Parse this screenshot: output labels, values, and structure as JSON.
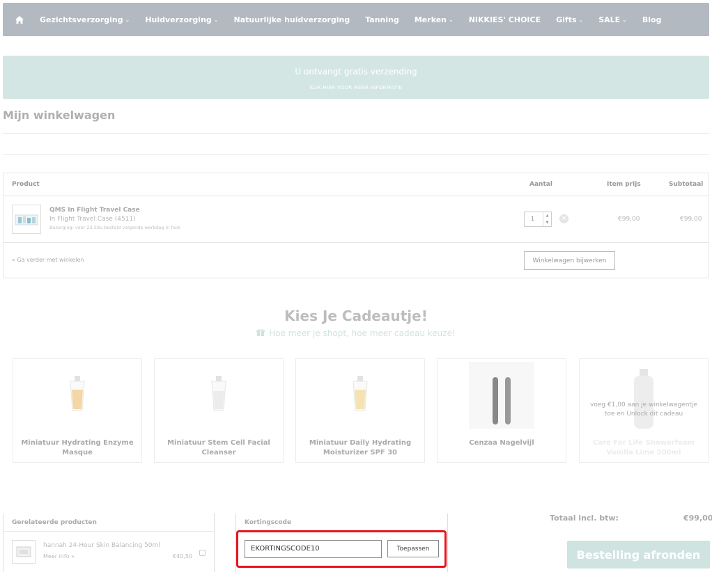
{
  "nav": {
    "items": [
      {
        "label": "Gezichtsverzorging",
        "dropdown": true
      },
      {
        "label": "Huidverzorging",
        "dropdown": true
      },
      {
        "label": "Natuurlijke huidverzorging",
        "dropdown": false
      },
      {
        "label": "Tanning",
        "dropdown": false
      },
      {
        "label": "Merken",
        "dropdown": true
      },
      {
        "label": "NIKKIES' CHOICE",
        "dropdown": false
      },
      {
        "label": "Gifts",
        "dropdown": true
      },
      {
        "label": "SALE",
        "dropdown": true
      },
      {
        "label": "Blog",
        "dropdown": false
      }
    ],
    "chevron": "⌄",
    "home_icon": "home-icon"
  },
  "banner": {
    "line1": "U ontvangt gratis verzending",
    "line2": "KLIK HIER VOOR MEER INFORMATIE"
  },
  "page_title": "Mijn winkelwagen",
  "cart": {
    "headers": {
      "product": "Product",
      "qty": "Aantal",
      "item_price": "Item prijs",
      "subtotal": "Subtotaal"
    },
    "items": [
      {
        "name": "QMS In Flight Travel Case",
        "variant": "In Flight Travel Case (4511)",
        "delivery": "Bezorging: vóór 23:59u besteld volgende werkdag in huis",
        "qty": "1",
        "price": "€99,00",
        "subtotal": "€99,00"
      }
    ],
    "continue_link": "« Ga verder met winkelen",
    "update_button": "Winkelwagen bijwerken"
  },
  "gifts": {
    "title": "Kies Je Cadeautje!",
    "subtitle": "Hoe meer je shopt, hoe meer cadeau keuze!",
    "items": [
      {
        "name": "Miniatuur Hydrating Enzyme Masque",
        "locked": false
      },
      {
        "name": "Miniatuur Stem Cell Facial Cleanser",
        "locked": false
      },
      {
        "name": "Miniatuur Daily Hydrating Moisturizer SPF 30",
        "locked": false
      },
      {
        "name": "Cenzaa Nagelvijl",
        "locked": false
      },
      {
        "name": "Care For Life Showerfoam Vanilla Lime 200ml",
        "locked": true,
        "unlock_text": "voeg €1,00 aan je winkelwagentje toe en Unlock dit cadeau"
      }
    ]
  },
  "related": {
    "title": "Gerelateerde producten",
    "items": [
      {
        "name": "hannah 24-Hour Skin Balancing 50ml",
        "more": "Meer info »",
        "price": "€40,50"
      }
    ]
  },
  "coupon": {
    "title": "Kortingscode",
    "value": "EKORTINGSCODE10",
    "button": "Toepassen",
    "highlight_color": "#e8141b"
  },
  "totals": {
    "label": "Totaal incl. btw:",
    "value": "€99,00"
  },
  "checkout_button": "Bestelling afronden",
  "colors": {
    "nav_bg": "#b3b9c0",
    "banner_bg": "#d4e6e4",
    "accent": "#cfe3e1"
  }
}
